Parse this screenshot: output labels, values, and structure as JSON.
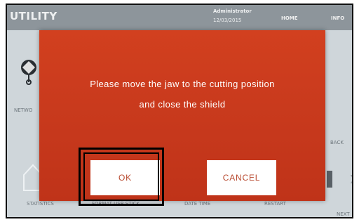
{
  "app": {
    "title": "UTILITY",
    "user": "Administrator",
    "date": "12/03/2015"
  },
  "nav": {
    "home": "HOME",
    "info": "INFO"
  },
  "tiles": {
    "network": "NETWO",
    "statistics": "STATISTICS",
    "format": "FORMAT USB STICK",
    "datetime": "DATE TIME",
    "restart": "RESTART",
    "back": "BACK",
    "next": "NEXT"
  },
  "dialog": {
    "line1": "Please move the jaw to the cutting position",
    "line2": "and close the shield",
    "ok_label": "OK",
    "cancel_label": "CANCEL"
  },
  "colors": {
    "dialog_bg": "#c93a1d",
    "button_text": "#b8492f",
    "topbar": "#8d959b"
  },
  "icons": [
    "network-icon",
    "home-icon",
    "chevron-right-icon"
  ]
}
